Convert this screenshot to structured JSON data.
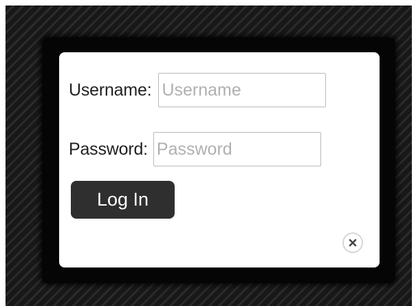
{
  "login": {
    "username_label": "Username:",
    "username_placeholder": "Username",
    "username_value": "",
    "password_label": "Password:",
    "password_placeholder": "Password",
    "password_value": "",
    "login_button_label": "Log In"
  },
  "icons": {
    "close": "close-icon"
  },
  "colors": {
    "button_bg": "#2f2f2f",
    "button_text": "#ffffff",
    "backdrop": "#1c1c1c",
    "modal_bg": "#ffffff"
  }
}
